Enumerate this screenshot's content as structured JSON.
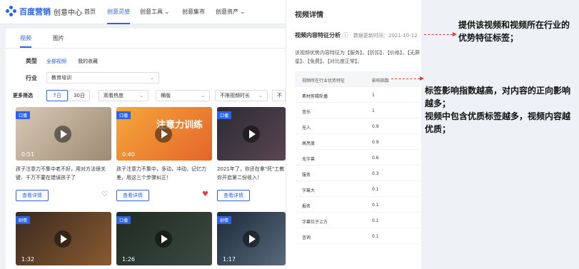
{
  "brand": {
    "name": "百度营销",
    "sub": "创意中心"
  },
  "nav": [
    "首页",
    "创意灵感",
    "创意工具",
    "创意集市",
    "创意资产"
  ],
  "content_tabs": [
    "视频",
    "图片"
  ],
  "filters": {
    "type_label": "类型",
    "type_options": [
      "全部视频",
      "我的收藏"
    ],
    "industry_label": "行业",
    "industry_value": "教育培训",
    "more_label": "更多筛选",
    "day_options": [
      "7日",
      "30日"
    ],
    "heat_select": "观看热度",
    "orientation_select": "横版",
    "duration_select": "不限视频时长",
    "extra_select": "不限"
  },
  "cards": [
    {
      "tag": "口播",
      "duration": "0:51",
      "desc": "孩子注意力不集中老不好，用对方法很关键，千万不要在错误孩子了",
      "button": "查看详情",
      "liked": false
    },
    {
      "tag": "口播",
      "duration": "0:40",
      "desc": "孩子注意力不集中，多动，冲动，记忆力差，用这三个步骤纠正！",
      "button": "查看详情",
      "liked": true,
      "overlay": "注意力训练"
    },
    {
      "tag": "口播",
      "duration": "",
      "desc": "2021年了，你还在拿\"死\"工教你开启第二份收入！",
      "button": "查看详情",
      "liked": false
    },
    {
      "tag": "剧情",
      "duration": "1:32",
      "desc": "",
      "button": "",
      "liked": false
    },
    {
      "tag": "口播",
      "duration": "1:26",
      "desc": "",
      "button": "",
      "liked": false
    },
    {
      "tag": "剧情",
      "duration": "1:17",
      "desc": "",
      "button": "",
      "liked": false
    }
  ],
  "detail": {
    "title": "视频详情",
    "subtitle": "视频内容特征分析",
    "update_time": "数据更新时间：2021-10-12",
    "description": "该视频优势内容特征为【服务】、【折扣】、【价格】、【无屏星】、【免费】、【对比度正常】。",
    "table_head": [
      "视频所在行业优势特征",
      "影响指数"
    ],
    "rows": [
      {
        "feature": "素材剪辑轮播",
        "value": "1"
      },
      {
        "feature": "音乐",
        "value": "1"
      },
      {
        "feature": "无人",
        "value": "0.9"
      },
      {
        "feature": "高亮度",
        "value": "0.9"
      },
      {
        "feature": "无字幕",
        "value": "0.6"
      },
      {
        "feature": "服务",
        "value": "0.3"
      },
      {
        "feature": "字幕大",
        "value": "0.1"
      },
      {
        "feature": "报名",
        "value": "0.1"
      },
      {
        "feature": "字幕位于上方",
        "value": "0.1"
      },
      {
        "feature": "咨询",
        "value": "0.1"
      }
    ]
  },
  "annotations": {
    "top": "提供该视频和视频所在行业的优势特征标签；",
    "middle_1": "标签影响指数越高，对内容的正向影响越多；",
    "middle_2": "视频中包含优质标签越多，视频内容越优质；"
  },
  "colors": {
    "accent": "#2b62e6",
    "annotation_arrow": "#e03b3b"
  }
}
